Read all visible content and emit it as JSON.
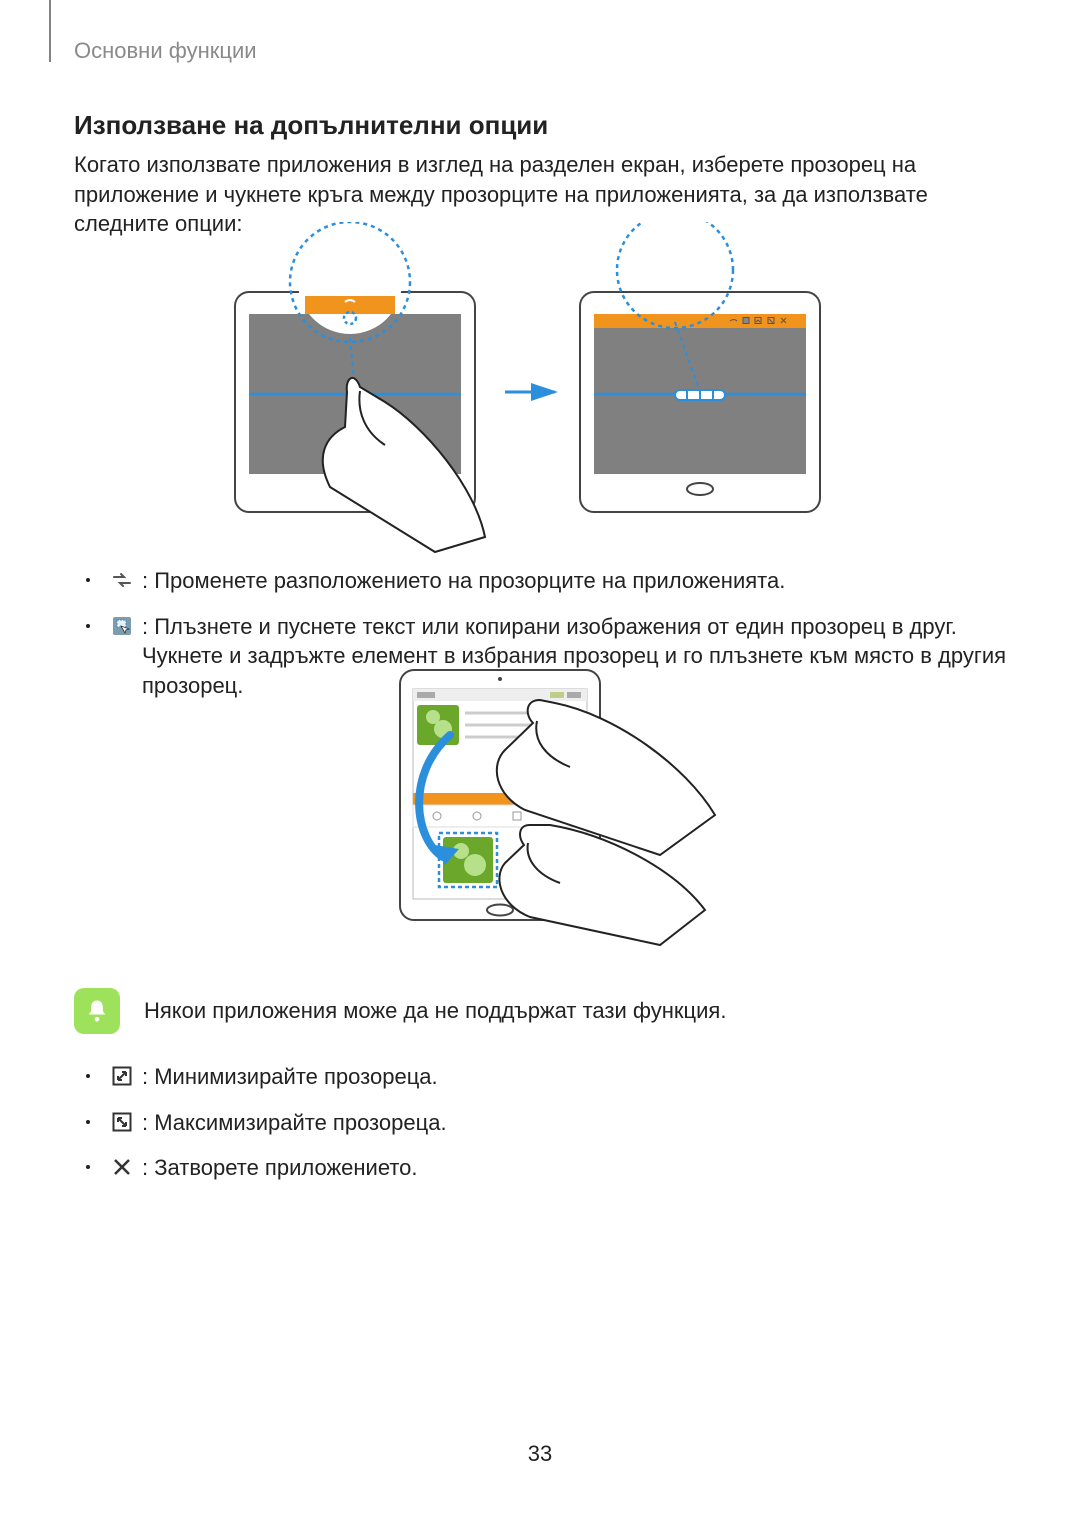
{
  "header": "Основни функции",
  "title": "Използване на допълнителни опции",
  "intro": "Когато използвате приложения в изглед на разделен екран, изберете прозорец на приложение и чукнете кръга между прозорците на приложенията, за да използвате следните опции:",
  "bullets": {
    "swap": " : Променете разположението на прозорците на приложенията.",
    "drag": " : Плъзнете и пуснете текст или копирани изображения от един прозорец в друг. Чукнете и задръжте елемент в избрания прозорец и го плъзнете към място в другия прозорец.",
    "minimize": " : Минимизирайте прозореца.",
    "maximize": " : Максимизирайте прозореца.",
    "close": " : Затворете приложението."
  },
  "note": "Някои приложения може да не поддържат тази функция.",
  "page": "33"
}
